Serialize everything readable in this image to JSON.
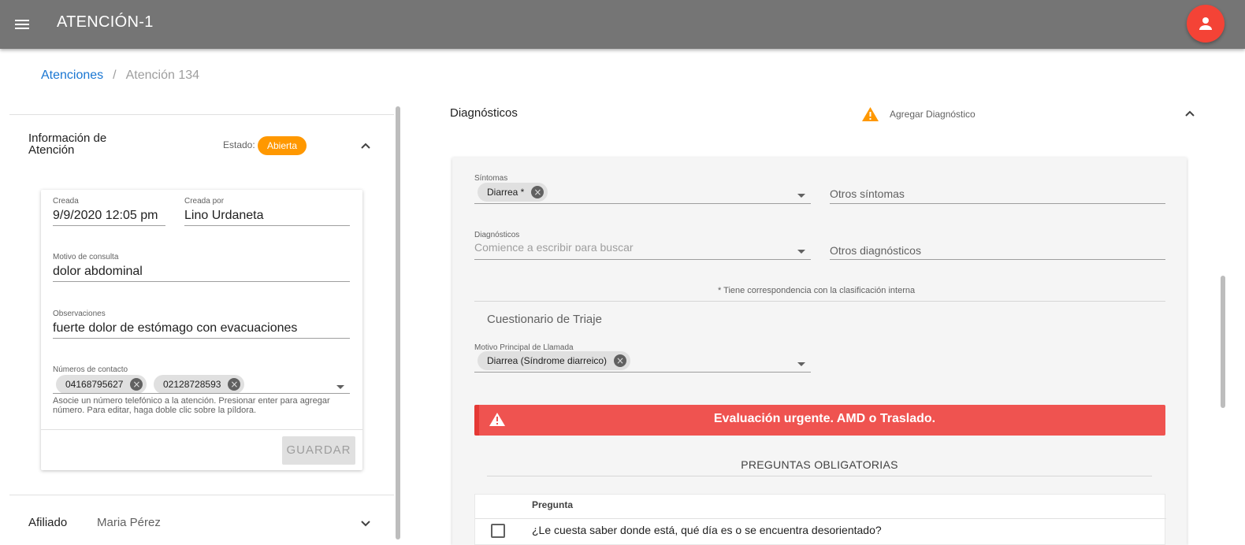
{
  "app": {
    "title": "ATENCIÓN-1"
  },
  "breadcrumb": {
    "link": "Atenciones",
    "separator": "/",
    "current": "Atención 134"
  },
  "info": {
    "title": "Información de Atención",
    "estado_label": "Estado:",
    "estado_value": "Abierta",
    "created_label": "Creada",
    "created_value": "9/9/2020 12:05 pm",
    "created_by_label": "Creada por",
    "created_by_value": "Lino Urdaneta",
    "motivo_label": "Motivo de consulta",
    "motivo_value": "dolor abdominal",
    "obs_label": "Observaciones",
    "obs_value": "fuerte dolor de estómago con evacuaciones",
    "contact_label": "Números de contacto",
    "contacts": [
      "04168795627",
      "02128728593"
    ],
    "hint": "Asocie un número telefónico a la atención. Presionar enter para agregar número. Para editar, haga doble clic sobre la píldora.",
    "save_label": "GUARDAR"
  },
  "afiliado": {
    "label": "Afiliado",
    "value": "Maria Pérez"
  },
  "diagnosticos": {
    "title": "Diagnósticos",
    "add_label": "Agregar Diagnóstico",
    "sintomas_label": "Síntomas",
    "sintomas_chip": "Diarrea *",
    "otros_sintomas": "Otros síntomas",
    "diag_label": "Diagnósticos",
    "diag_placeholder": "Comience a escribir para buscar",
    "otros_diag": "Otros diagnósticos",
    "note": "* Tiene correspondencia con la clasificación interna",
    "triaje_title": "Cuestionario de Triaje",
    "motivo_llamada_label": "Motivo Principal de Llamada",
    "motivo_llamada_chip": "Diarrea (Síndrome diarreico)",
    "alert_text": "Evaluación urgente. AMD o Traslado.",
    "preguntas_title": "PREGUNTAS OBLIGATORIAS",
    "table_header": "Pregunta",
    "question_1": "¿Le cuesta saber donde está, qué día es o se encuentra desorientado?"
  },
  "colors": {
    "appbar": "#757575",
    "avatar": "#f44336",
    "badge": "#ff9800",
    "alert": "#ef5350",
    "link": "#1976d2"
  },
  "icons": [
    "menu-icon",
    "person-icon",
    "chevron-up-icon",
    "chevron-down-icon",
    "warning-icon",
    "cancel-icon",
    "dropdown-arrow-icon",
    "checkbox-icon"
  ]
}
